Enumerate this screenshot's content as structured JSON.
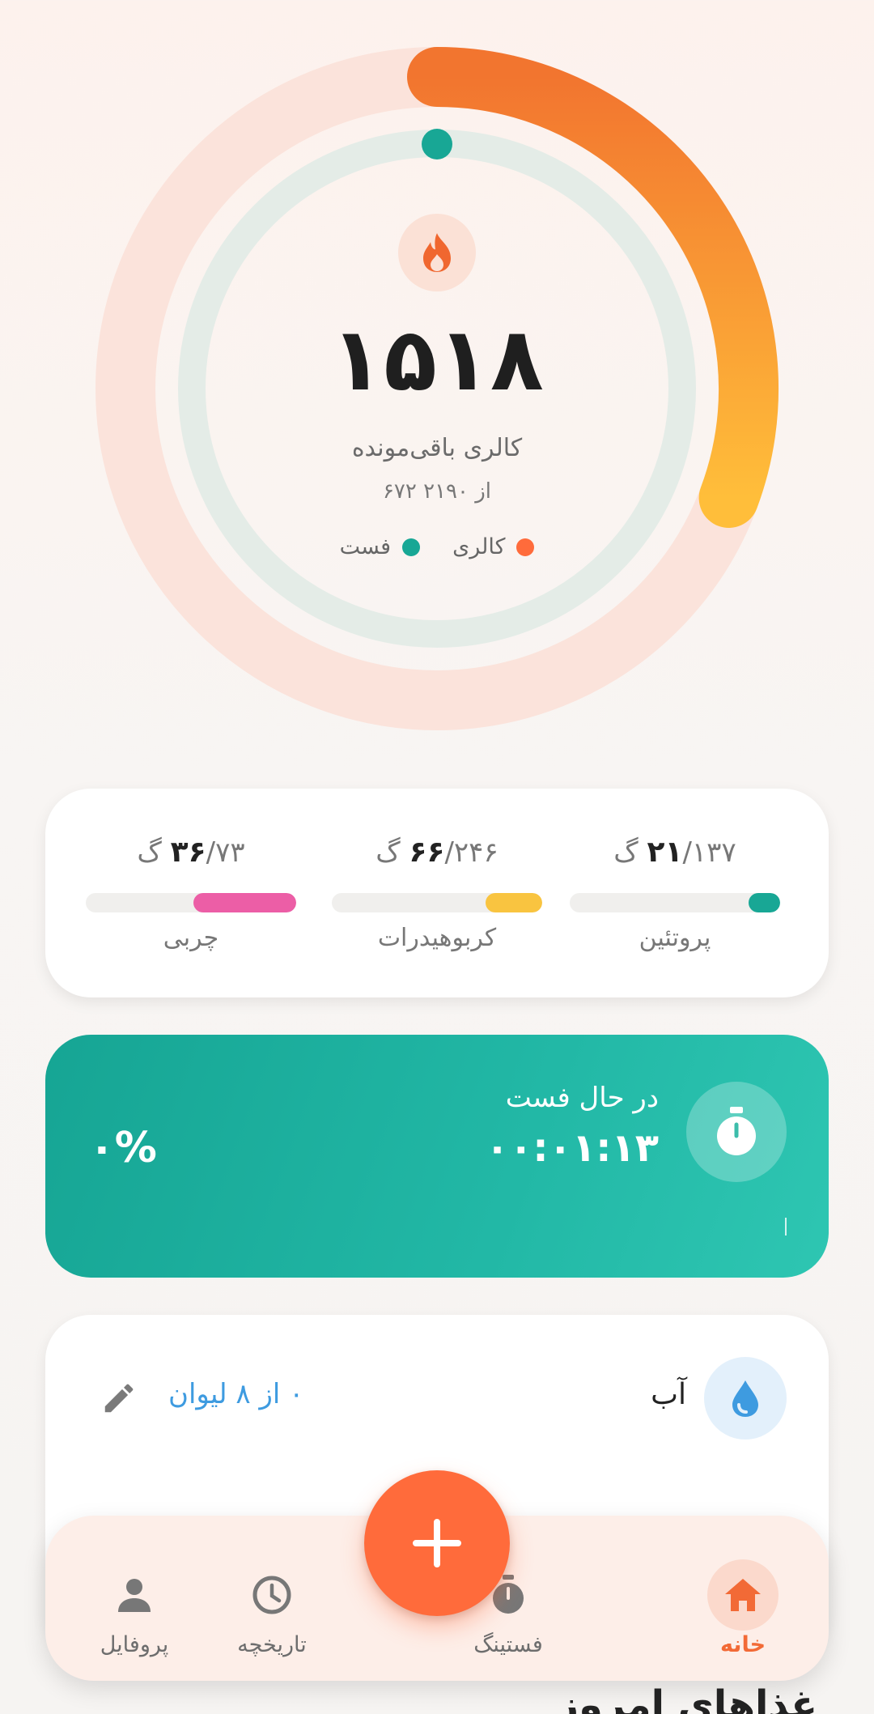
{
  "summary": {
    "remaining_calories": "۱۵۱۸",
    "remaining_label": "کالری باقی‌مونده",
    "consumed_of_goal": "۶۷۲ از ۲۱۹۰",
    "calorie_progress": 0.307,
    "legend": [
      {
        "label": "کالری",
        "color": "#ff6b3b"
      },
      {
        "label": "فست",
        "color": "#18a795"
      }
    ]
  },
  "macros": [
    {
      "name": "پروتئین",
      "current": "۲۱",
      "goal": "/۱۳۷ گ",
      "progress": 0.15,
      "color": "#18a795"
    },
    {
      "name": "کربوهیدرات",
      "current": "۶۶",
      "goal": "/۲۴۶ گ",
      "progress": 0.27,
      "color": "#f9c440"
    },
    {
      "name": "چربی",
      "current": "۳۶",
      "goal": "/۷۳ گ",
      "progress": 0.49,
      "color": "#ec5ea6"
    }
  ],
  "fasting": {
    "title": "در حال فست",
    "elapsed": "۰۰:۰۱:۱۳",
    "percent": "۰%"
  },
  "water": {
    "title": "آب",
    "count": "۰ از ۸ لیوان"
  },
  "nav": {
    "home": "خانه",
    "fasting": "فستینگ",
    "history": "تاریخچه",
    "profile": "پروفایل"
  },
  "next_section_heading": "غذاهای امروز",
  "colors": {
    "accent": "#ff6b3b",
    "teal": "#18a795",
    "water": "#3e9be0"
  }
}
